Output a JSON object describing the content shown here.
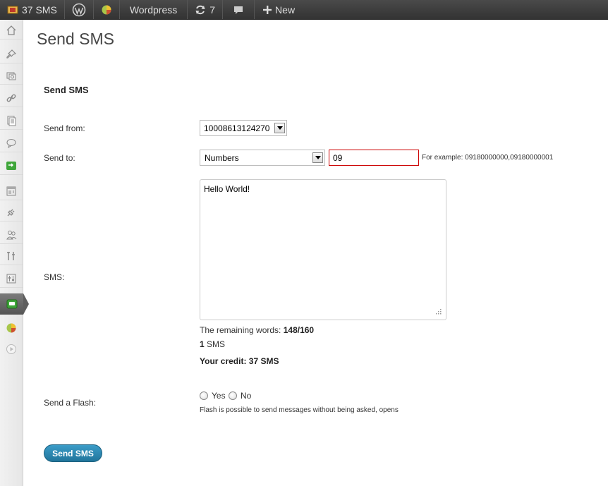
{
  "adminbar": {
    "sms_balance": "37 SMS",
    "site_name": "Wordpress",
    "updates_count": "7",
    "new_label": "New"
  },
  "page": {
    "title": "Send SMS",
    "section_title": "Send SMS"
  },
  "form": {
    "send_from_label": "Send from:",
    "send_from_value": "10008613124270",
    "send_to_label": "Send to:",
    "send_to_type": "Numbers",
    "send_to_number": "09",
    "example_hint": "For example: 09180000000,09180000001",
    "sms_label": "SMS:",
    "sms_text": "Hello World!",
    "remaining_prefix": "The remaining words: ",
    "remaining_value": "148/160",
    "sms_count": "1",
    "sms_count_unit": " SMS",
    "credit_text": "Your credit: 37 SMS",
    "flash_label": "Send a Flash:",
    "flash_yes": "Yes",
    "flash_no": "No",
    "flash_note": "Flash is possible to send messages without being asked, opens",
    "submit_label": "Send SMS"
  },
  "colors": {
    "adminbar_bg": "#464646",
    "button_blue": "#21759b",
    "error_border": "#cc0000",
    "sms_green": "#3fa63a"
  }
}
